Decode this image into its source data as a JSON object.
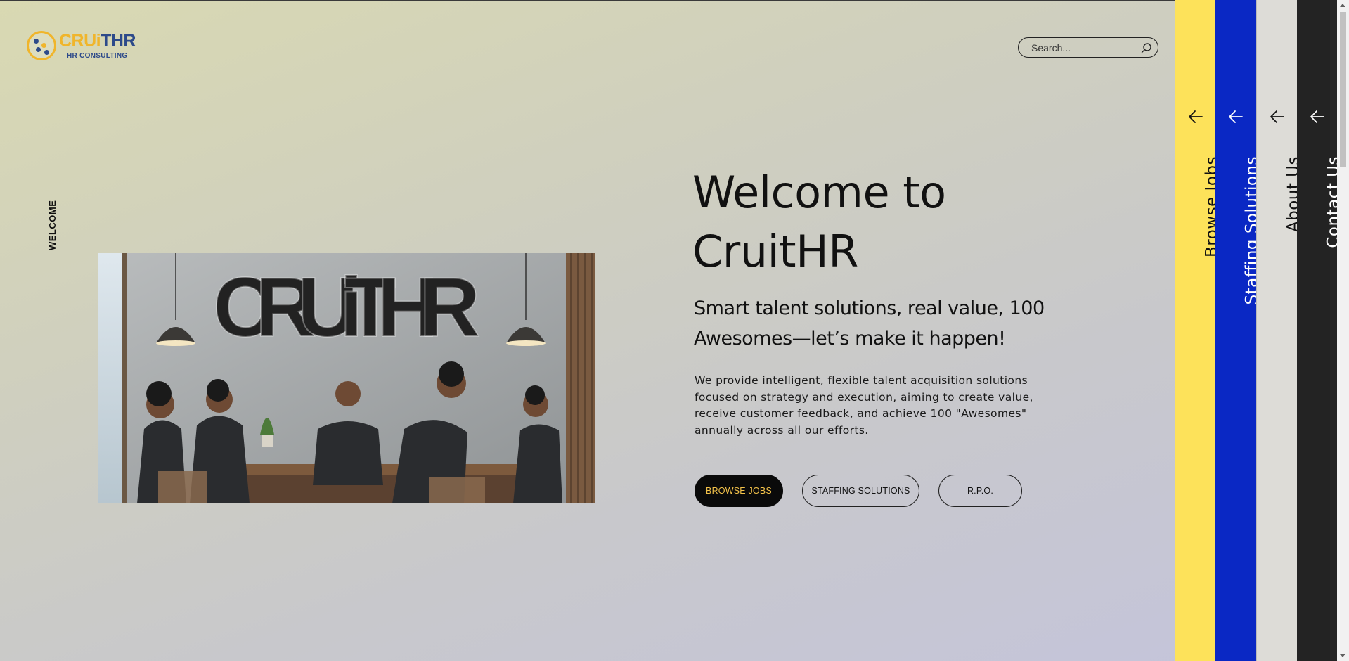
{
  "brand": {
    "logo_part1": "CRUi",
    "logo_part2": "THR",
    "logo_subtitle": "HR CONSULTING",
    "colors": {
      "gold": "#f0b52b",
      "navy": "#2d4a8a"
    }
  },
  "search": {
    "placeholder": "Search...",
    "value": "",
    "icon": "search-icon"
  },
  "side_label": "WELCOME",
  "hero_image": {
    "sign_text": "CRUiTHR"
  },
  "hero": {
    "title": "Welcome to CruitHR",
    "subtitle": "Smart talent solutions, real value, 100 Awesomes—let’s make it happen!",
    "description": "We provide intelligent, flexible talent acquisition solutions focused on strategy and execution, aiming to create value, receive customer feedback, and achieve 100 \"Awesomes\" annually across all our efforts."
  },
  "buttons": {
    "browse_jobs": "BROWSE JOBS",
    "staffing_solutions": "STAFFING SOLUTIONS",
    "rpo": "R.P.O."
  },
  "side_panels": [
    {
      "label": "Browse Jobs",
      "icon": "arrow-left-icon",
      "bg": "#fde25a",
      "fg": "#111111"
    },
    {
      "label": "Staffing Solutions",
      "icon": "arrow-left-icon",
      "bg": "#0a28c4",
      "fg": "#ffffff"
    },
    {
      "label": "About Us",
      "icon": "arrow-left-icon",
      "bg": "#dddcd7",
      "fg": "#111111"
    },
    {
      "label": "Contact Us",
      "icon": "arrow-left-icon",
      "bg": "#232323",
      "fg": "#ffffff"
    }
  ],
  "theme": {
    "button_primary_bg": "#0a0a0a",
    "button_primary_text": "#f3c24a"
  }
}
